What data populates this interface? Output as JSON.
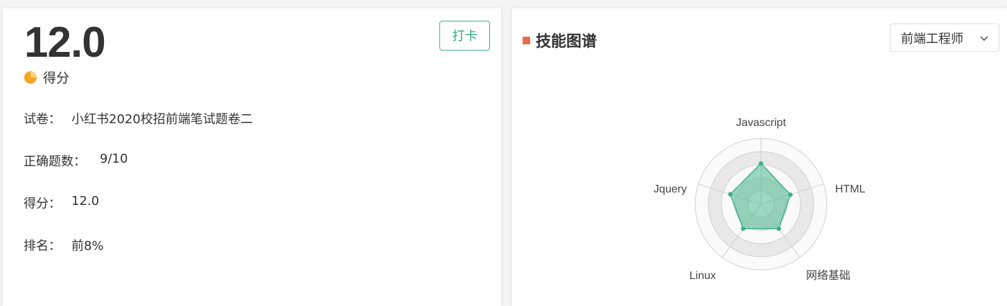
{
  "result": {
    "score_big": "12.0",
    "score_caption": "得分",
    "checkin_label": "打卡"
  },
  "info": {
    "paper": {
      "label": "试卷：",
      "value": "小红书2020校招前端笔试题卷二"
    },
    "correct": {
      "label": "正确题数：",
      "value": "9/10"
    },
    "score": {
      "label": "得分：",
      "value": "12.0"
    },
    "rank": {
      "label": "排名：",
      "value": "前8%"
    }
  },
  "skills": {
    "title": "技能图谱",
    "role_select": "前端工程师",
    "chart_data": {
      "type": "radar",
      "axes": [
        "Javascript",
        "HTML",
        "网络基础",
        "Linux",
        "Jquery"
      ],
      "rings": 5,
      "values": [
        0.62,
        0.47,
        0.46,
        0.46,
        0.49
      ],
      "max": 1
    }
  },
  "colors": {
    "accent_green": "#3aaf8e",
    "accent_red": "#ee6a4a",
    "pie_icon": "#f5a623",
    "radar_fill": "rgba(79,186,146,0.55)",
    "radar_stroke": "#3aaf8e"
  }
}
